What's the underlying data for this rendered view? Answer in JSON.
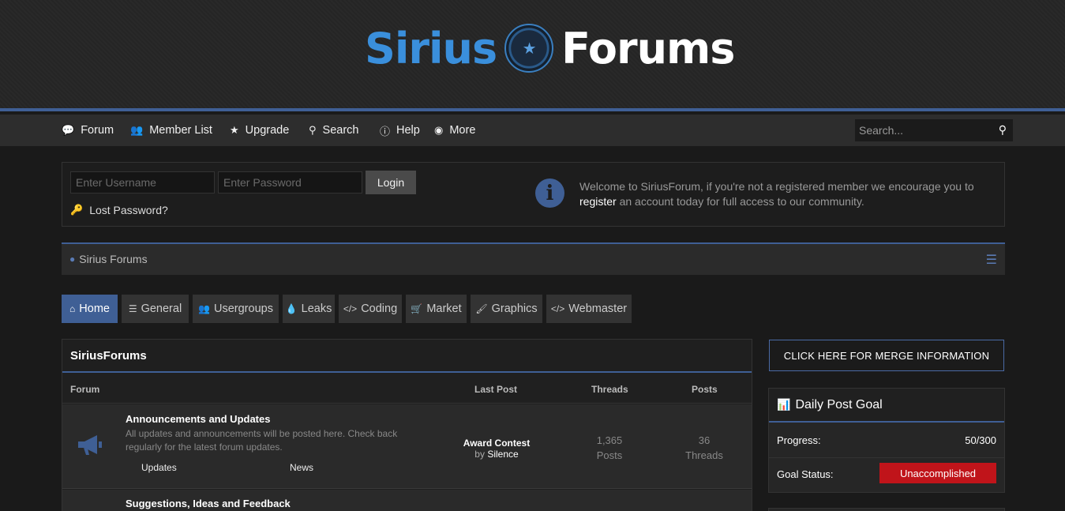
{
  "header": {
    "logo_left": "Sirius",
    "logo_right": "Forums"
  },
  "nav": {
    "items": [
      {
        "label": "Forum",
        "icon": "comments-icon"
      },
      {
        "label": "Member List",
        "icon": "users-icon"
      },
      {
        "label": "Upgrade",
        "icon": "star-icon"
      },
      {
        "label": "Search",
        "icon": "search-icon"
      },
      {
        "label": "Help",
        "icon": "info-icon"
      },
      {
        "label": "More",
        "icon": "compass-icon"
      }
    ],
    "search_placeholder": "Search..."
  },
  "login": {
    "username_placeholder": "Enter Username",
    "password_placeholder": "Enter Password",
    "login_label": "Login",
    "lost_password": "Lost Password?",
    "welcome_before": "Welcome to SiriusForum, if you're not a registered member we encourage you to ",
    "welcome_link": "register",
    "welcome_after": " an account today for full access to our community."
  },
  "breadcrumb": {
    "label": "Sirius Forums"
  },
  "tabs": [
    {
      "label": "Home",
      "icon": "home-icon",
      "active": true
    },
    {
      "label": "General",
      "icon": "list-icon"
    },
    {
      "label": "Usergroups",
      "icon": "users-icon"
    },
    {
      "label": "Leaks",
      "icon": "drop-icon"
    },
    {
      "label": "Coding",
      "icon": "code-icon"
    },
    {
      "label": "Market",
      "icon": "cart-icon"
    },
    {
      "label": "Graphics",
      "icon": "brush-icon"
    },
    {
      "label": "Webmaster",
      "icon": "code-icon"
    }
  ],
  "forum": {
    "title": "SiriusForums",
    "columns": {
      "forum": "Forum",
      "last_post": "Last Post",
      "threads": "Threads",
      "posts": "Posts"
    },
    "rows": [
      {
        "title": "Announcements and Updates",
        "description": "All updates and announcements will be posted here. Check back regularly for the latest forum updates.",
        "subforums": [
          "Updates",
          "News"
        ],
        "last_post_title": "Award Contest",
        "last_post_by": "by",
        "last_post_user": "Silence",
        "threads_value": "1,365",
        "threads_unit": "Posts",
        "posts_value": "36",
        "posts_unit": "Threads"
      },
      {
        "title": "Suggestions, Ideas and Feedback"
      }
    ]
  },
  "sidebar": {
    "merge_label": "CLICK HERE FOR MERGE INFORMATION",
    "goal_title": "Daily Post Goal",
    "progress_label": "Progress:",
    "progress_value": "50/300",
    "status_label": "Goal Status:",
    "status_value": "Unaccomplished"
  },
  "colors": {
    "accent": "#3f5f95",
    "logo_blue": "#3a8fdc",
    "status_red": "#c0141a"
  }
}
